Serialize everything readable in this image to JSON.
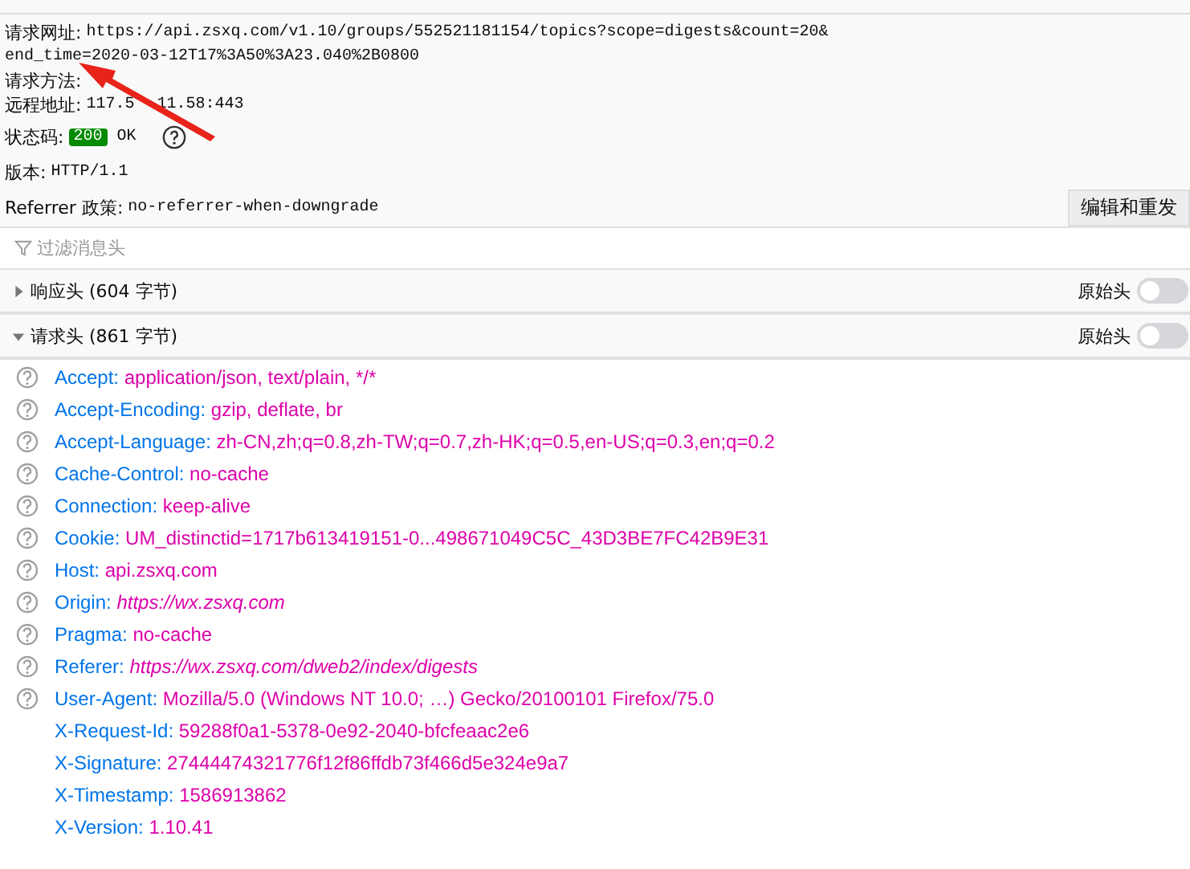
{
  "summary": {
    "url_label": "请求网址:",
    "url": "https://api.zsxq.com/v1.10/groups/552521181154/topics?scope=digests&count=20&",
    "url_continued": "end_time=2020-03-12T17%3A50%3A23.040%2B0800",
    "method_label": "请求方法:",
    "remote_label": "远程地址:",
    "remote_parts": [
      "117.5",
      "11.58:443"
    ],
    "status_label": "状态码:",
    "status_code": "200",
    "status_text": "OK",
    "version_label": "版本:",
    "version": "HTTP/1.1",
    "referrer_label": "Referrer 政策:",
    "referrer": "no-referrer-when-downgrade",
    "resend_button": "编辑和重发"
  },
  "filter": {
    "placeholder": "过滤消息头"
  },
  "sections": [
    {
      "title": "响应头 (604 字节)",
      "expanded": false,
      "raw_label": "原始头",
      "raw_on": false
    },
    {
      "title": "请求头 (861 字节)",
      "expanded": true,
      "raw_label": "原始头",
      "raw_on": false
    }
  ],
  "request_headers": [
    {
      "name": "Accept:",
      "value": "application/json, text/plain, */*",
      "help": true,
      "kind": "text"
    },
    {
      "name": "Accept-Encoding:",
      "value": "gzip, deflate, br",
      "help": true,
      "kind": "text"
    },
    {
      "name": "Accept-Language:",
      "value": "zh-CN,zh;q=0.8,zh-TW;q=0.7,zh-HK;q=0.5,en-US;q=0.3,en;q=0.2",
      "help": true,
      "kind": "text"
    },
    {
      "name": "Cache-Control:",
      "value": "no-cache",
      "help": true,
      "kind": "text"
    },
    {
      "name": "Connection:",
      "value": "keep-alive",
      "help": true,
      "kind": "text"
    },
    {
      "name": "Cookie:",
      "value": "UM_distinctid=1717b613419151-0...498671049C5C_43D3BE7FC42B9E31",
      "help": true,
      "kind": "text"
    },
    {
      "name": "Host:",
      "value": "api.zsxq.com",
      "help": true,
      "kind": "text"
    },
    {
      "name": "Origin:",
      "value": "https://wx.zsxq.com",
      "help": true,
      "kind": "link"
    },
    {
      "name": "Pragma:",
      "value": "no-cache",
      "help": true,
      "kind": "text"
    },
    {
      "name": "Referer:",
      "value": "https://wx.zsxq.com/dweb2/index/digests",
      "help": true,
      "kind": "link"
    },
    {
      "name": "User-Agent:",
      "value": "Mozilla/5.0 (Windows NT 10.0; …) Gecko/20100101 Firefox/75.0",
      "help": true,
      "kind": "text"
    },
    {
      "name": "X-Request-Id:",
      "value": "59288f0a1-5378-0e92-2040-bfcfeaac2e6",
      "help": false,
      "kind": "text"
    },
    {
      "name": "X-Signature:",
      "value": "27444474321776f12f86ffdb73f466d5e324e9a7",
      "help": false,
      "kind": "text"
    },
    {
      "name": "X-Timestamp:",
      "value": "1586913862",
      "help": false,
      "kind": "text"
    },
    {
      "name": "X-Version:",
      "value": "1.10.41",
      "help": false,
      "kind": "text"
    }
  ]
}
